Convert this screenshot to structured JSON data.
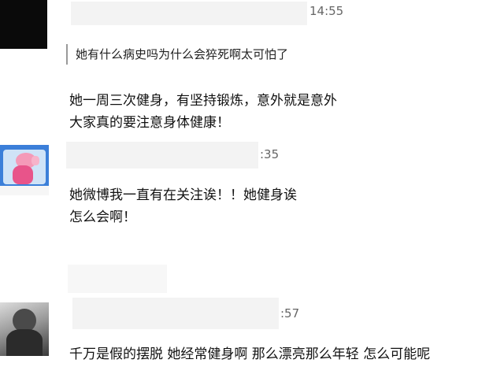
{
  "comments": [
    {
      "time": "14:55",
      "quote": "她有什么病史吗为什么会猝死啊太可怕了",
      "lines": [
        "她一周三次健身，有坚持锻炼，意外就是意外",
        "大家真的要注意身体健康！"
      ]
    },
    {
      "time": ":35",
      "lines": [
        "她微博我一直有在关注诶！！她健身诶",
        "怎么会啊！"
      ]
    },
    {
      "time": ":57",
      "lines": [
        "千万是假的摆脱 她经常健身啊 那么漂亮那么年轻 怎么可能呢"
      ]
    }
  ]
}
